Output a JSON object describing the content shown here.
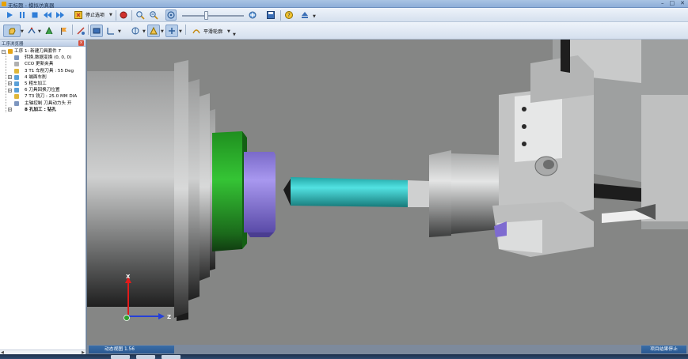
{
  "window": {
    "title": "无标题 - 模拟仿真器",
    "min": "–",
    "max": "□",
    "close": "✕"
  },
  "toolbar1": {
    "stop_options_label": "停止选项",
    "buttons": [
      "play-icon",
      "step-icon",
      "stop-icon",
      "rewind-icon",
      "fast-forward-icon",
      "stop-options-icon",
      "record-icon",
      "zoom-icon",
      "zoom-fit-icon",
      "view-rotate-icon",
      "settings-icon",
      "save-icon",
      "help-icon",
      "eject-icon"
    ]
  },
  "toolbar2": {
    "smooth_label": "平滑轮廓"
  },
  "panel": {
    "title": "工序浏览器",
    "close": "x",
    "tree": [
      {
        "expander": "−",
        "label": "工序 1:  新建刀具套件 7",
        "bold": false
      },
      {
        "expander": "",
        "label": "转换,数据变换  (0, 0, 0)",
        "bold": false
      },
      {
        "expander": "",
        "label": "CCO 更新夹具",
        "bold": false
      },
      {
        "expander": "",
        "label": "3 T1 车削刀具 : 55 Deg",
        "bold": false
      },
      {
        "expander": "+",
        "label": "4 端面车削",
        "bold": false
      },
      {
        "expander": "+",
        "label": "5 粗车加工",
        "bold": false
      },
      {
        "expander": "+",
        "label": "6 刀具回换刀位置",
        "bold": false
      },
      {
        "expander": "",
        "label": "7 T3 铣刀 : 25.0 MM DIA",
        "bold": false
      },
      {
        "expander": "",
        "label": "主轴控制 刀具动力头 开",
        "bold": false
      },
      {
        "expander": "+",
        "label": "8 孔加工 : 钻孔",
        "bold": true
      }
    ]
  },
  "viewport": {
    "axis_x_label": "X",
    "axis_z_label": "Z"
  },
  "status": {
    "left": "动态视图 1.56",
    "right": "项目结果停止"
  },
  "colors": {
    "viewport_bg": "#858685",
    "green_part": "#1fa21f",
    "purple_part": "#8877d6",
    "cyan_tool": "#2ec3c3",
    "status_blue": "#2f63a0"
  }
}
